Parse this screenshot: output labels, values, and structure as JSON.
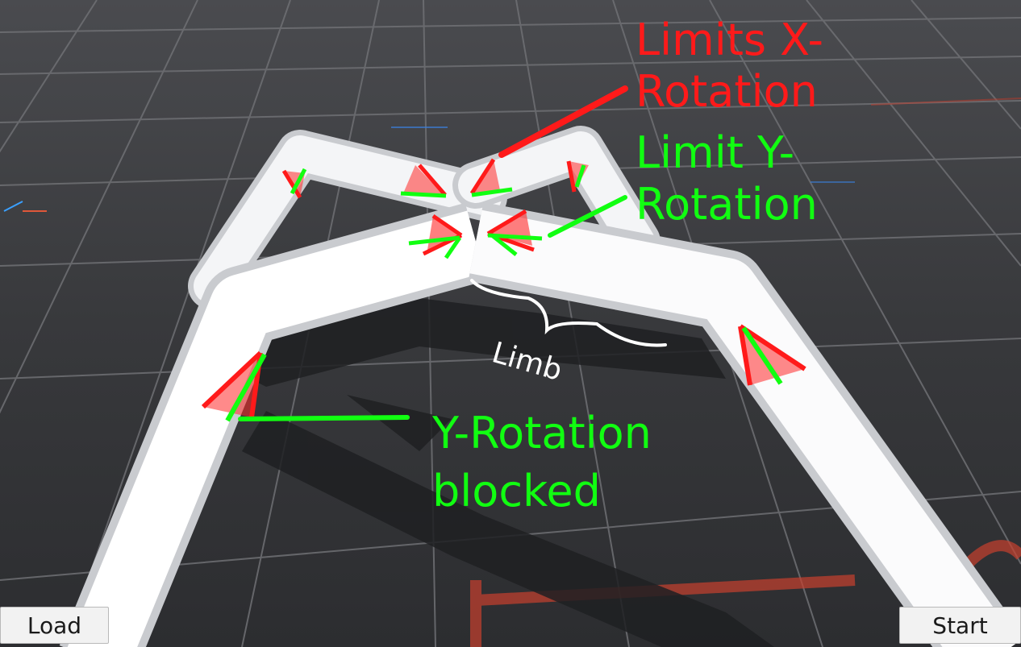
{
  "annotations": {
    "limits_x_line1": "Limits X-",
    "limits_x_line2": "Rotation",
    "limit_y_line1": "Limit Y-",
    "limit_y_line2": "Rotation",
    "limb": "Limb",
    "y_blocked_line1": "Y-Rotation",
    "y_blocked_line2": "blocked"
  },
  "buttons": {
    "load": "Load",
    "start": "Start"
  },
  "colors": {
    "x_rotation": "#ff1a1a",
    "y_rotation": "#11ff11",
    "limb_annotation": "#ffffff",
    "background": "#2f3033"
  }
}
